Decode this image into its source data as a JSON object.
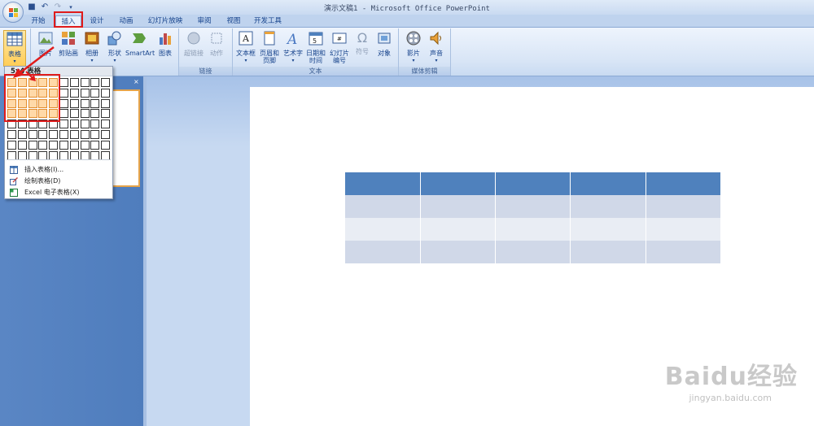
{
  "window": {
    "title": "演示文稿1 - Microsoft Office PowerPoint"
  },
  "tabs": [
    "开始",
    "插入",
    "设计",
    "动画",
    "幻灯片放映",
    "审阅",
    "视图",
    "开发工具"
  ],
  "active_tab": "插入",
  "ribbon": {
    "table_label": "表格",
    "illustration_buttons": [
      "图片",
      "剪贴画",
      "相册",
      "形状",
      "SmartArt",
      "图表"
    ],
    "link_buttons": [
      "超链接",
      "动作"
    ],
    "link_group_label": "链接",
    "text_buttons": [
      {
        "line1": "文本框",
        "line2": ""
      },
      {
        "line1": "页眉和",
        "line2": "页脚"
      },
      {
        "line1": "艺术字",
        "line2": ""
      },
      {
        "line1": "日期和",
        "line2": "时间"
      },
      {
        "line1": "幻灯片",
        "line2": "编号"
      },
      {
        "line1": "符号",
        "line2": ""
      },
      {
        "line1": "对象",
        "line2": ""
      }
    ],
    "text_group_label": "文本",
    "media_buttons": [
      "影片",
      "声音"
    ],
    "media_group_label": "媒体剪辑"
  },
  "table_dropdown": {
    "header": "5x4 表格",
    "grid_cols": 10,
    "grid_rows": 8,
    "selected_cols": 5,
    "selected_rows": 4,
    "items": [
      {
        "label": "插入表格(I)...",
        "icon": "insert-table-icon"
      },
      {
        "label": "绘制表格(D)",
        "icon": "draw-table-icon"
      },
      {
        "label": "Excel 电子表格(X)",
        "icon": "excel-icon"
      }
    ]
  },
  "slide_table": {
    "columns": 5,
    "rows": 4,
    "colors": {
      "header": "#4f81bd",
      "band_dark": "#d0d8e8",
      "band_light": "#e9edf4"
    }
  },
  "panel": {
    "close_glyph": "×"
  },
  "watermark": {
    "brand": "Baidu经验",
    "url": "jingyan.baidu.com"
  }
}
